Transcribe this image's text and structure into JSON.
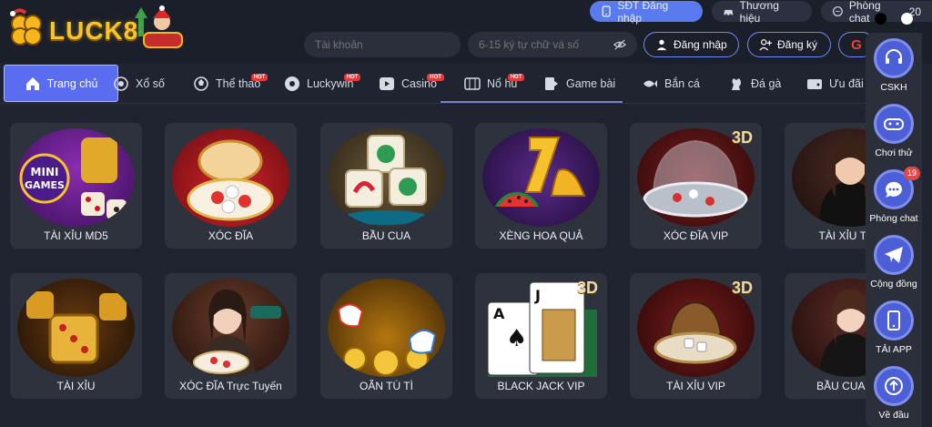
{
  "brand": {
    "name": "LUCK8"
  },
  "header": {
    "login_phone": "SĐT Đăng nhập",
    "brand_link": "Thương hiệu",
    "chat_room": "Phòng chat",
    "extra": "20",
    "account_placeholder": "Tài khoản",
    "password_placeholder": "6-15 ký tự chữ và số",
    "login": "Đăng nhập",
    "register": "Đăng ký"
  },
  "nav": {
    "items": [
      {
        "label": "Trang chủ",
        "icon": "home-icon",
        "hot": false
      },
      {
        "label": "Xổ số",
        "icon": "lottery-icon",
        "hot": false
      },
      {
        "label": "Thể thao",
        "icon": "sports-icon",
        "hot": true
      },
      {
        "label": "Luckywin",
        "icon": "ball-icon",
        "hot": true
      },
      {
        "label": "Casino",
        "icon": "casino-icon",
        "hot": true
      },
      {
        "label": "Nổ hũ",
        "icon": "slot-icon",
        "hot": true
      },
      {
        "label": "Game bài",
        "icon": "cards-icon",
        "hot": false
      },
      {
        "label": "Bắn cá",
        "icon": "fish-icon",
        "hot": false
      },
      {
        "label": "Đá gà",
        "icon": "rooster-icon",
        "hot": false
      },
      {
        "label": "Ưu đãi",
        "icon": "wallet-icon",
        "hot": false
      }
    ],
    "hot_label": "HOT"
  },
  "games": [
    {
      "label": "TÀI XỈU MD5",
      "art": "mini-games"
    },
    {
      "label": "XÓC ĐĨA",
      "art": "bowl"
    },
    {
      "label": "BẦU CUA",
      "art": "dice-animals"
    },
    {
      "label": "XÈNG HOA QUẢ",
      "art": "fruits"
    },
    {
      "label": "XÓC ĐĨA VIP",
      "art": "glass-dome"
    },
    {
      "label": "TÀI XỈU Trực",
      "art": "dealer"
    },
    {
      "label": "TÀI XỈU",
      "art": "gold-dice"
    },
    {
      "label": "XÓC ĐĨA Trực Tuyến",
      "art": "dealer-live"
    },
    {
      "label": "OẴN TÙ TÌ",
      "art": "coins-hands"
    },
    {
      "label": "BLACK JACK VIP",
      "art": "cards-3d"
    },
    {
      "label": "TÀI XỈU VIP",
      "art": "dice-cup"
    },
    {
      "label": "BẦU CUA Trự",
      "art": "dealer-2"
    }
  ],
  "sidebar": {
    "items": [
      {
        "label": "CSKH",
        "icon": "support-icon"
      },
      {
        "label": "Chơi thử",
        "icon": "gamepad-icon"
      },
      {
        "label": "Phòng chat",
        "icon": "chat-icon",
        "badge": "19"
      },
      {
        "label": "Cộng đồng",
        "icon": "telegram-icon"
      },
      {
        "label": "TẢI APP",
        "icon": "phone-icon"
      },
      {
        "label": "Về đầu",
        "icon": "arrow-up-icon"
      }
    ]
  },
  "colors": {
    "accent": "#5a6cf0",
    "gold": "#f7c52b",
    "bg": "#1f2430"
  }
}
